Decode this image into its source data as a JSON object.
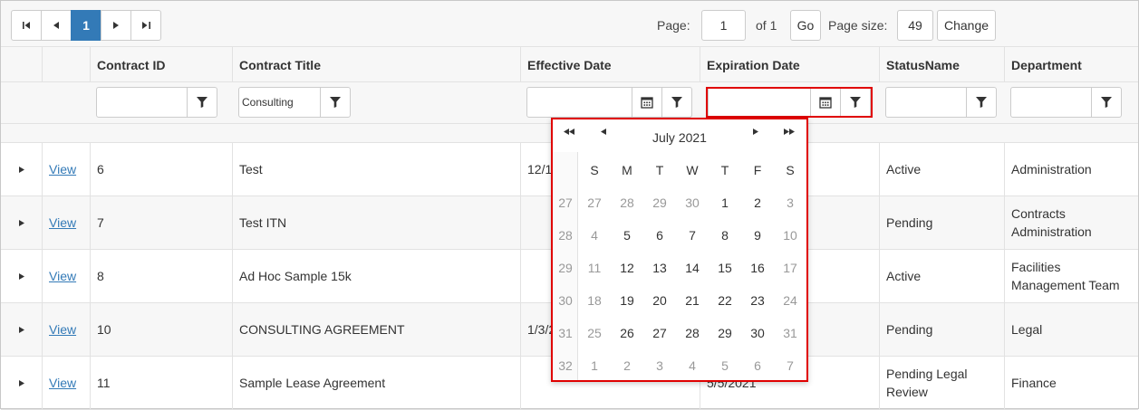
{
  "pager": {
    "page_numbers": [
      "1"
    ],
    "page_label": "Page:",
    "page_value": "1",
    "of_label": "of 1",
    "go_label": "Go",
    "size_label": "Page size:",
    "size_value": "49",
    "change_label": "Change"
  },
  "columns": [
    "Contract ID",
    "Contract Title",
    "Effective Date",
    "Expiration Date",
    "StatusName",
    "Department"
  ],
  "filters": {
    "contract_id": "",
    "contract_title": "Consulting",
    "effective_date": "",
    "expiration_date": "",
    "status": "",
    "department": ""
  },
  "rows": [
    {
      "view": "View",
      "id": "6",
      "title": "Test",
      "effective": "12/1",
      "expiration": "",
      "status": "Active",
      "department": "Administration"
    },
    {
      "view": "View",
      "id": "7",
      "title": "Test ITN",
      "effective": "",
      "expiration": "",
      "status": "Pending",
      "department": "Contracts Administration"
    },
    {
      "view": "View",
      "id": "8",
      "title": "Ad Hoc Sample 15k",
      "effective": "",
      "expiration": "",
      "status": "Active",
      "department": "Facilities Management Team"
    },
    {
      "view": "View",
      "id": "10",
      "title": "CONSULTING AGREEMENT",
      "effective": "1/3/2",
      "expiration": "",
      "status": "Pending",
      "department": "Legal"
    },
    {
      "view": "View",
      "id": "11",
      "title": "Sample Lease Agreement",
      "effective": "",
      "expiration": "5/5/2021",
      "status": "Pending Legal Review",
      "department": "Finance"
    }
  ],
  "datepicker": {
    "month_label": "July 2021",
    "weekdays": [
      "S",
      "M",
      "T",
      "W",
      "T",
      "F",
      "S"
    ],
    "weeks": [
      {
        "num": "27",
        "days": [
          {
            "d": "27",
            "m": true
          },
          {
            "d": "28",
            "m": true
          },
          {
            "d": "29",
            "m": true
          },
          {
            "d": "30",
            "m": true
          },
          {
            "d": "1",
            "m": false
          },
          {
            "d": "2",
            "m": false
          },
          {
            "d": "3",
            "m": true
          }
        ]
      },
      {
        "num": "28",
        "days": [
          {
            "d": "4",
            "m": true
          },
          {
            "d": "5",
            "m": false
          },
          {
            "d": "6",
            "m": false
          },
          {
            "d": "7",
            "m": false
          },
          {
            "d": "8",
            "m": false
          },
          {
            "d": "9",
            "m": false
          },
          {
            "d": "10",
            "m": true
          }
        ]
      },
      {
        "num": "29",
        "days": [
          {
            "d": "11",
            "m": true
          },
          {
            "d": "12",
            "m": false
          },
          {
            "d": "13",
            "m": false
          },
          {
            "d": "14",
            "m": false
          },
          {
            "d": "15",
            "m": false
          },
          {
            "d": "16",
            "m": false
          },
          {
            "d": "17",
            "m": true
          }
        ]
      },
      {
        "num": "30",
        "days": [
          {
            "d": "18",
            "m": true
          },
          {
            "d": "19",
            "m": false
          },
          {
            "d": "20",
            "m": false
          },
          {
            "d": "21",
            "m": false
          },
          {
            "d": "22",
            "m": false
          },
          {
            "d": "23",
            "m": false
          },
          {
            "d": "24",
            "m": true
          }
        ]
      },
      {
        "num": "31",
        "days": [
          {
            "d": "25",
            "m": true
          },
          {
            "d": "26",
            "m": false
          },
          {
            "d": "27",
            "m": false
          },
          {
            "d": "28",
            "m": false
          },
          {
            "d": "29",
            "m": false
          },
          {
            "d": "30",
            "m": false
          },
          {
            "d": "31",
            "m": true
          }
        ]
      },
      {
        "num": "32",
        "days": [
          {
            "d": "1",
            "m": true
          },
          {
            "d": "2",
            "m": true
          },
          {
            "d": "3",
            "m": true
          },
          {
            "d": "4",
            "m": true
          },
          {
            "d": "5",
            "m": true
          },
          {
            "d": "6",
            "m": true
          },
          {
            "d": "7",
            "m": true
          }
        ]
      }
    ]
  },
  "icons": {
    "filter": "filter-icon",
    "calendar": "calendar-icon",
    "expand": "expand-arrow-icon"
  },
  "colors": {
    "accent": "#337ab7",
    "highlight": "#e00000",
    "muted": "#999999"
  }
}
